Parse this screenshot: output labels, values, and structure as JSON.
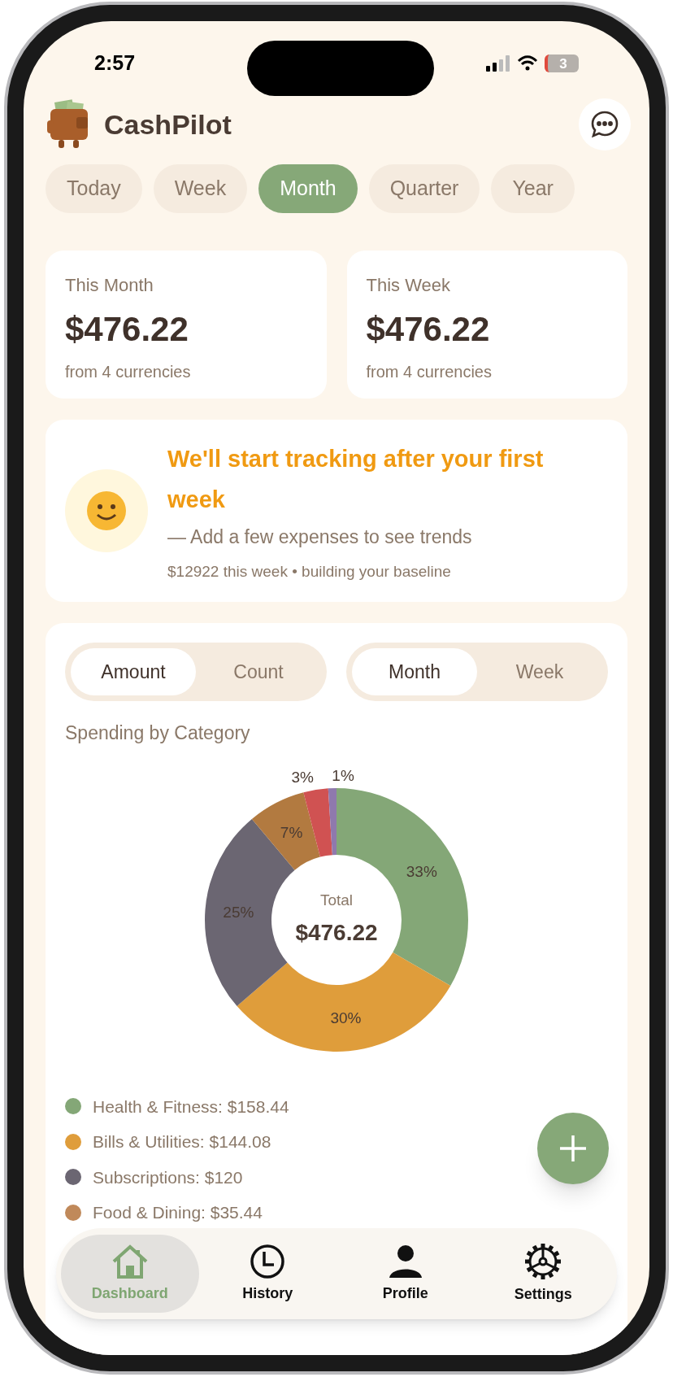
{
  "status_bar": {
    "time": "2:57",
    "battery": "3"
  },
  "app": {
    "title": "CashPilot"
  },
  "period_tabs": [
    {
      "label": "Today",
      "selected": false
    },
    {
      "label": "Week",
      "selected": false
    },
    {
      "label": "Month",
      "selected": true
    },
    {
      "label": "Quarter",
      "selected": false
    },
    {
      "label": "Year",
      "selected": false
    }
  ],
  "summary_cards": [
    {
      "label": "This Month",
      "amount": "$476.22",
      "note": "from 4 currencies"
    },
    {
      "label": "This Week",
      "amount": "$476.22",
      "note": "from 4 currencies"
    }
  ],
  "tracking_card": {
    "title": "We'll start tracking after your first week",
    "subtitle": "— Add a few expenses to see trends",
    "note": "$12922 this week • building your baseline"
  },
  "chart_card": {
    "toggles": [
      [
        {
          "label": "Amount",
          "selected": true
        },
        {
          "label": "Count",
          "selected": false
        }
      ],
      [
        {
          "label": "Month",
          "selected": true
        },
        {
          "label": "Week",
          "selected": false
        }
      ]
    ],
    "title": "Spending by Category",
    "center_label": "Total",
    "center_value": "$476.22",
    "chart_data": {
      "type": "donut",
      "values": [
        33,
        30,
        25,
        7,
        3,
        1
      ],
      "value_labels": [
        "33%",
        "30%",
        "25%",
        "7%",
        "3%",
        "1%"
      ],
      "colors": [
        "#84a777",
        "#df9d3b",
        "#6b6672",
        "#b27a40",
        "#d05252",
        "#8f79ad"
      ]
    },
    "legend": [
      {
        "label": "Health & Fitness: $158.44",
        "color": "#84a777"
      },
      {
        "label": "Bills & Utilities: $144.08",
        "color": "#df9d3b"
      },
      {
        "label": "Subscriptions: $120",
        "color": "#6b6672"
      },
      {
        "label": "Food & Dining: $35.44",
        "color": "#c0895a"
      }
    ]
  },
  "nav": [
    {
      "label": "Dashboard",
      "kind": "home",
      "selected": true
    },
    {
      "label": "History",
      "kind": "clock",
      "selected": false
    },
    {
      "label": "Profile",
      "kind": "person",
      "selected": false
    },
    {
      "label": "Settings",
      "kind": "gear",
      "selected": false
    }
  ]
}
